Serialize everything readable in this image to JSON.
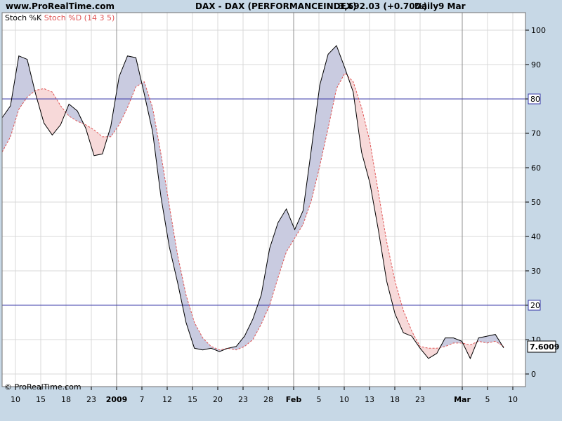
{
  "header": {
    "site": "www.ProRealTime.com",
    "instrument": "DAX - DAX (PERFORMANCEINDEX)",
    "price": "3,692.03 (+0.70%)",
    "period": "Daily",
    "date": "9 Mar"
  },
  "copyright": "© ProRealTime.com",
  "legend": {
    "k_label": "Stoch %K",
    "d_label": "Stoch %D (14 3 5)"
  },
  "colors": {
    "k_line": "#000000",
    "d_line": "#e05555",
    "k_above_fill": "#c9cbe0",
    "d_above_fill": "#f7d9d9",
    "ref_line": "#3a3aa8",
    "grid": "#d8d8d8",
    "background": "#ffffff",
    "frame_bg": "#c7d8e6"
  },
  "chart_data": {
    "type": "line",
    "title": "DAX - DAX (PERFORMANCEINDEX)",
    "ylim": [
      -5,
      102
    ],
    "y_ticks": [
      0,
      10,
      20,
      30,
      40,
      50,
      60,
      70,
      80,
      90,
      100
    ],
    "reference_lines": [
      20,
      80
    ],
    "last_value_label": "7.6009",
    "x_tick_labels": [
      "10",
      "15",
      "18",
      "23",
      "2009",
      "7",
      "12",
      "15",
      "20",
      "23",
      "28",
      "Feb",
      "5",
      "10",
      "13",
      "18",
      "23",
      "Mar",
      "5",
      "10"
    ],
    "x_tick_bold": [
      "2009",
      "Feb",
      "Mar"
    ],
    "series": [
      {
        "name": "Stoch %K",
        "values": [
          74.5,
          78.0,
          92.5,
          91.5,
          81.5,
          73.0,
          69.5,
          72.5,
          78.5,
          76.5,
          71.5,
          63.5,
          64.0,
          72.0,
          86.5,
          92.5,
          92.0,
          81.5,
          70.5,
          51.5,
          37.0,
          26.5,
          15.0,
          7.5,
          7.0,
          7.5,
          6.5,
          7.5,
          8.0,
          11.0,
          16.0,
          23.0,
          36.5,
          44.0,
          48.0,
          42.0,
          47.5,
          65.5,
          84.0,
          93.0,
          95.5,
          89.0,
          82.0,
          64.5,
          55.5,
          42.0,
          27.0,
          17.5,
          12.0,
          11.0,
          7.5,
          4.5,
          6.0,
          10.5,
          10.5,
          9.5,
          4.5,
          10.5,
          11.0,
          11.5,
          7.6
        ]
      },
      {
        "name": "Stoch %D (14 3 5)",
        "values": [
          64.5,
          69.0,
          77.0,
          80.5,
          82.5,
          83.0,
          82.0,
          78.0,
          75.0,
          73.5,
          72.5,
          71.0,
          69.0,
          69.0,
          72.5,
          77.5,
          83.5,
          85.0,
          77.5,
          64.0,
          49.0,
          34.5,
          23.0,
          15.0,
          10.5,
          8.0,
          7.0,
          7.5,
          7.0,
          8.0,
          10.0,
          14.5,
          20.0,
          28.0,
          35.5,
          39.5,
          43.5,
          50.5,
          60.5,
          71.5,
          83.0,
          87.5,
          85.0,
          77.5,
          67.5,
          53.0,
          38.5,
          27.0,
          18.5,
          12.5,
          8.0,
          7.5,
          7.5,
          8.0,
          9.0,
          9.0,
          8.5,
          9.5,
          9.0,
          9.5,
          8.0
        ]
      }
    ]
  }
}
